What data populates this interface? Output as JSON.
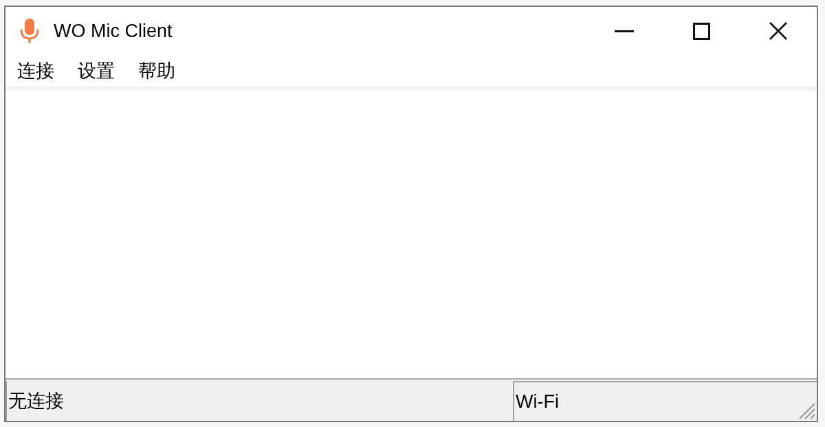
{
  "window": {
    "title": "WO Mic Client"
  },
  "menu": [
    {
      "label": "连接"
    },
    {
      "label": "设置"
    },
    {
      "label": "帮助"
    }
  ],
  "status_bar": {
    "panes": [
      {
        "text": "无连接"
      },
      {
        "text": "Wi-Fi"
      }
    ]
  }
}
